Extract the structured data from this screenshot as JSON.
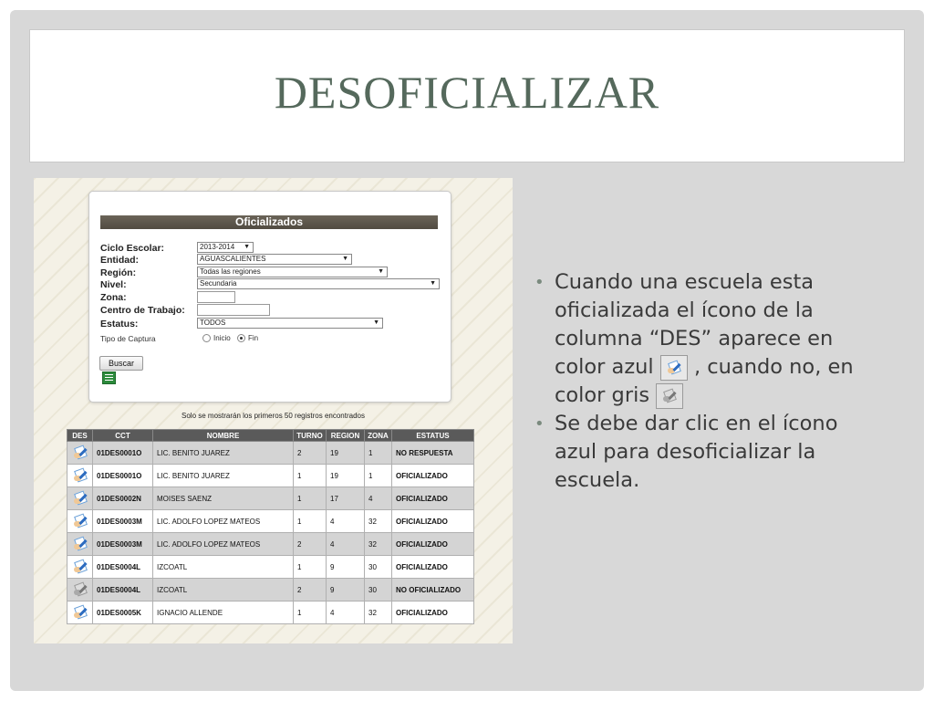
{
  "slide": {
    "title": "DESOFICIALIZAR"
  },
  "screenshot": {
    "panel_title": "Oficializados",
    "form": {
      "ciclo_label": "Ciclo Escolar:",
      "ciclo_value": "2013-2014",
      "entidad_label": "Entidad:",
      "entidad_value": "AGUASCALIENTES",
      "region_label": "Región:",
      "region_value": "Todas las regiones",
      "nivel_label": "Nivel:",
      "nivel_value": "Secundaria",
      "zona_label": "Zona:",
      "zona_value": "",
      "centro_label": "Centro de Trabajo:",
      "centro_value": "",
      "estatus_label": "Estatus:",
      "estatus_value": "TODOS",
      "tipo_label": "Tipo de Captura",
      "radio_inicio": "Inicio",
      "radio_fin": "Fin",
      "radio_selected": "Fin",
      "buscar_label": "Buscar"
    },
    "note": "Solo se mostrarán los primeros 50 registros encontrados",
    "table": {
      "headers": [
        "DES",
        "CCT",
        "NOMBRE",
        "TURNO",
        "REGION",
        "ZONA",
        "ESTATUS"
      ],
      "rows": [
        {
          "icon": "blue",
          "cct": "01DES0001O",
          "nombre": "LIC. BENITO JUAREZ",
          "turno": "2",
          "region": "19",
          "zona": "1",
          "estatus": "NO RESPUESTA"
        },
        {
          "icon": "blue",
          "cct": "01DES0001O",
          "nombre": "LIC. BENITO JUAREZ",
          "turno": "1",
          "region": "19",
          "zona": "1",
          "estatus": "OFICIALIZADO"
        },
        {
          "icon": "blue",
          "cct": "01DES0002N",
          "nombre": "MOISES SAENZ",
          "turno": "1",
          "region": "17",
          "zona": "4",
          "estatus": "OFICIALIZADO"
        },
        {
          "icon": "blue",
          "cct": "01DES0003M",
          "nombre": "LIC. ADOLFO LOPEZ MATEOS",
          "turno": "1",
          "region": "4",
          "zona": "32",
          "estatus": "OFICIALIZADO"
        },
        {
          "icon": "blue",
          "cct": "01DES0003M",
          "nombre": "LIC. ADOLFO LOPEZ MATEOS",
          "turno": "2",
          "region": "4",
          "zona": "32",
          "estatus": "OFICIALIZADO"
        },
        {
          "icon": "blue",
          "cct": "01DES0004L",
          "nombre": "IZCOATL",
          "turno": "1",
          "region": "9",
          "zona": "30",
          "estatus": "OFICIALIZADO"
        },
        {
          "icon": "gray",
          "cct": "01DES0004L",
          "nombre": "IZCOATL",
          "turno": "2",
          "region": "9",
          "zona": "30",
          "estatus": "NO OFICIALIZADO"
        },
        {
          "icon": "blue",
          "cct": "01DES0005K",
          "nombre": "IGNACIO ALLENDE",
          "turno": "1",
          "region": "4",
          "zona": "32",
          "estatus": "OFICIALIZADO"
        }
      ]
    }
  },
  "bullets": {
    "b1_part1": "Cuando una escuela esta oficializada el ícono de la columna “DES” aparece en color azul",
    "b1_part2": ", cuando no, en color gris",
    "b2": "Se debe dar clic en el ícono azul para desoficializar la escuela."
  },
  "colors": {
    "title": "#55695c",
    "slide_bg": "#d8d8d8",
    "table_header": "#5a5a5a",
    "panel_header": "#5e584d"
  }
}
